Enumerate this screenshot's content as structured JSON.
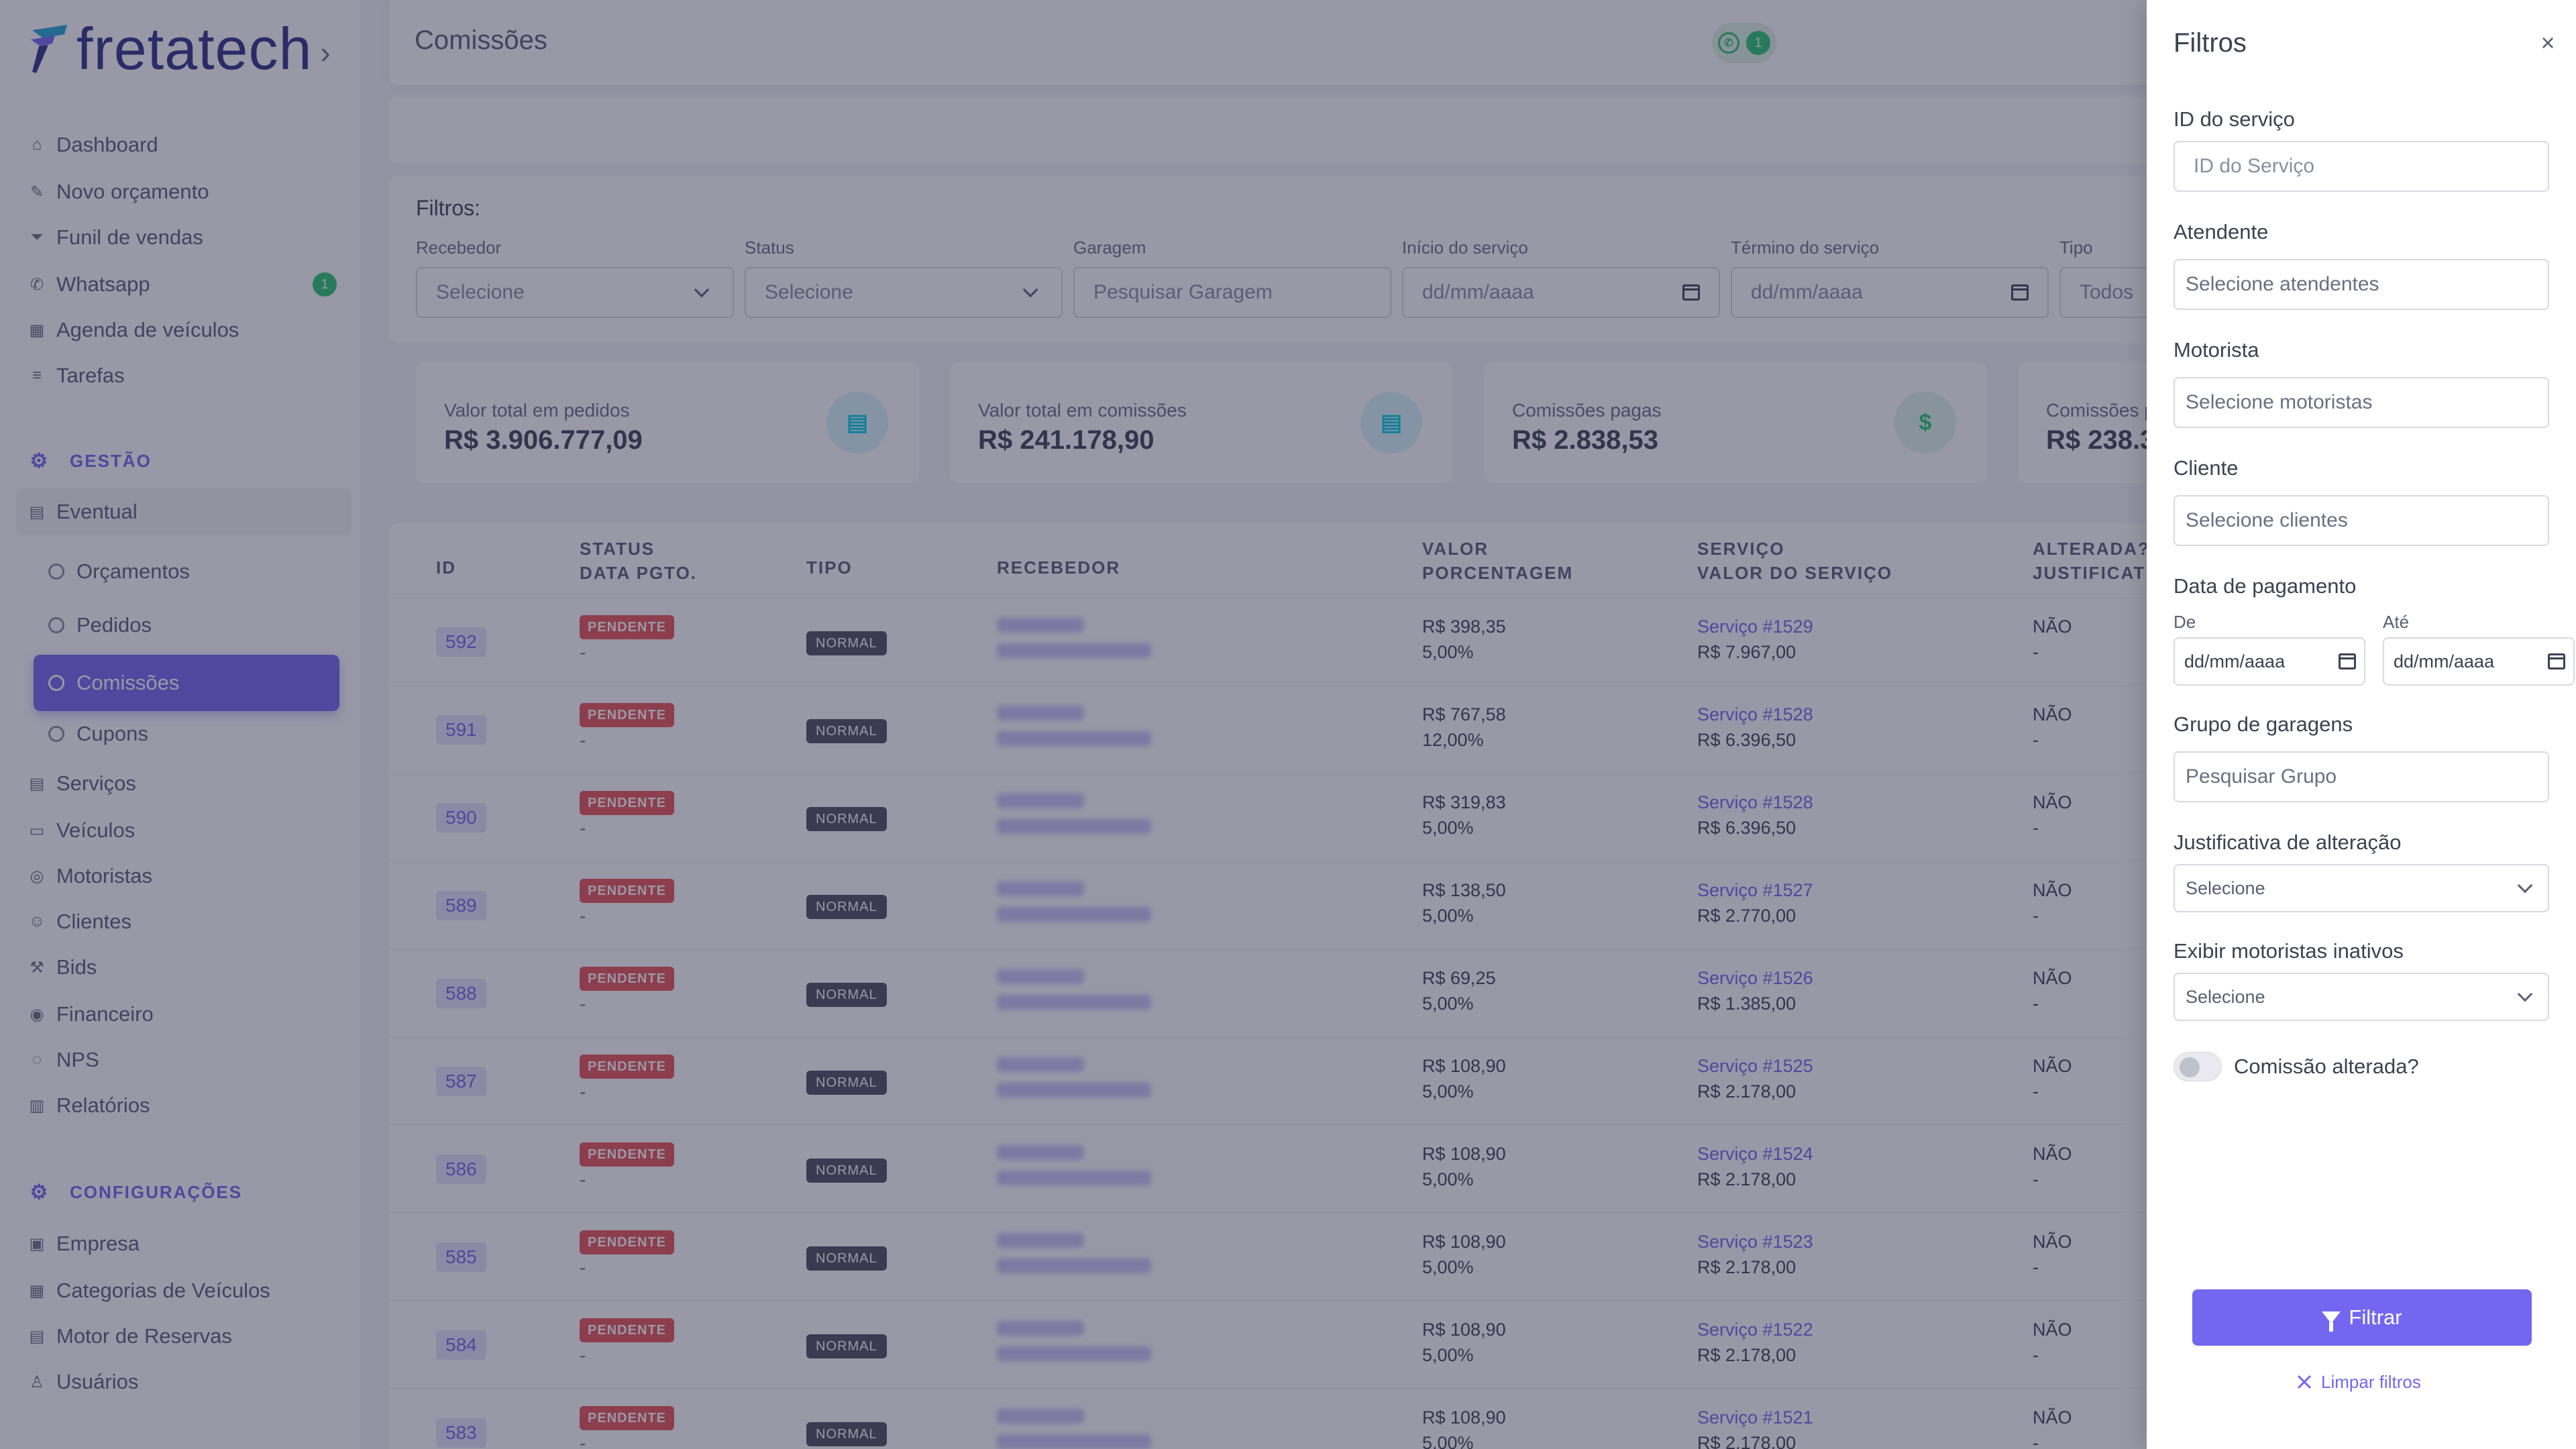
{
  "app": {
    "logo_text": "fretatech",
    "page_title": "Comissões",
    "whatsapp_count": "1"
  },
  "sidebar": {
    "top_items": [
      {
        "label": "Dashboard",
        "icon": "home-icon"
      },
      {
        "label": "Novo orçamento",
        "icon": "edit-icon"
      },
      {
        "label": "Funil de vendas",
        "icon": "funnel-icon"
      },
      {
        "label": "Whatsapp",
        "icon": "whatsapp-icon",
        "badge": "1"
      },
      {
        "label": "Agenda de veículos",
        "icon": "calendar-icon"
      },
      {
        "label": "Tarefas",
        "icon": "list-icon"
      }
    ],
    "section_gestao": "GESTÃO",
    "eventual": "Eventual",
    "eventual_sub": [
      "Orçamentos",
      "Pedidos",
      "Comissões",
      "Cupons"
    ],
    "gestao_items": [
      {
        "label": "Serviços",
        "icon": "clipboard-icon"
      },
      {
        "label": "Veículos",
        "icon": "bus-icon"
      },
      {
        "label": "Motoristas",
        "icon": "steering-wheel-icon"
      },
      {
        "label": "Clientes",
        "icon": "users-icon"
      },
      {
        "label": "Bids",
        "icon": "gavel-icon"
      },
      {
        "label": "Financeiro",
        "icon": "money-icon"
      },
      {
        "label": "NPS",
        "icon": "chat-icon"
      },
      {
        "label": "Relatórios",
        "icon": "report-icon"
      }
    ],
    "section_config": "CONFIGURAÇÕES",
    "config_items": [
      {
        "label": "Empresa",
        "icon": "building-icon"
      },
      {
        "label": "Categorias de Veículos",
        "icon": "grid-icon"
      },
      {
        "label": "Motor de Reservas",
        "icon": "table-icon"
      },
      {
        "label": "Usuários",
        "icon": "user-icon"
      }
    ]
  },
  "filters": {
    "title": "Filtros:",
    "fields": [
      {
        "label": "Recebedor",
        "value": "Selecione",
        "type": "select"
      },
      {
        "label": "Status",
        "value": "Selecione",
        "type": "select"
      },
      {
        "label": "Garagem",
        "value": "Pesquisar Garagem",
        "type": "text"
      },
      {
        "label": "Início do serviço",
        "value": "dd/mm/aaaa",
        "type": "date"
      },
      {
        "label": "Término do serviço",
        "value": "dd/mm/aaaa",
        "type": "date"
      },
      {
        "label": "Tipo",
        "value": "Todos",
        "type": "select"
      }
    ]
  },
  "stats": [
    {
      "label": "Valor total em pedidos",
      "value": "R$ 3.906.777,09",
      "icon": "document-icon",
      "color": "#00cfe8"
    },
    {
      "label": "Valor total em comissões",
      "value": "R$ 241.178,90",
      "icon": "document-icon",
      "color": "#00cfe8"
    },
    {
      "label": "Comissões pagas",
      "value": "R$ 2.838,53",
      "icon": "dollar-icon",
      "color": "#28c76f"
    },
    {
      "label": "Comissões p",
      "value": "R$ 238.3",
      "icon": "",
      "color": "#ea5455"
    }
  ],
  "table": {
    "headers": {
      "id": "ID",
      "status": "STATUS",
      "data_pgto": "DATA PGTO.",
      "tipo": "TIPO",
      "recebedor": "RECEBEDOR",
      "valor": "VALOR",
      "porcentagem": "PORCENTAGEM",
      "servico": "SERVIÇO",
      "valor_servico": "VALOR DO SERVIÇO",
      "alterada": "ALTERADA?",
      "justificativa": "JUSTIFICATIV"
    },
    "rows": [
      {
        "id": "592",
        "status": "PENDENTE",
        "data": "-",
        "tipo": "NORMAL",
        "valor": "R$ 398,35",
        "pct": "5,00%",
        "servico": "Serviço #1529",
        "valor_servico": "R$ 7.967,00",
        "alterada": "NÃO",
        "just": "-"
      },
      {
        "id": "591",
        "status": "PENDENTE",
        "data": "-",
        "tipo": "NORMAL",
        "valor": "R$ 767,58",
        "pct": "12,00%",
        "servico": "Serviço #1528",
        "valor_servico": "R$ 6.396,50",
        "alterada": "NÃO",
        "just": "-"
      },
      {
        "id": "590",
        "status": "PENDENTE",
        "data": "-",
        "tipo": "NORMAL",
        "valor": "R$ 319,83",
        "pct": "5,00%",
        "servico": "Serviço #1528",
        "valor_servico": "R$ 6.396,50",
        "alterada": "NÃO",
        "just": "-"
      },
      {
        "id": "589",
        "status": "PENDENTE",
        "data": "-",
        "tipo": "NORMAL",
        "valor": "R$ 138,50",
        "pct": "5,00%",
        "servico": "Serviço #1527",
        "valor_servico": "R$ 2.770,00",
        "alterada": "NÃO",
        "just": "-"
      },
      {
        "id": "588",
        "status": "PENDENTE",
        "data": "-",
        "tipo": "NORMAL",
        "valor": "R$ 69,25",
        "pct": "5,00%",
        "servico": "Serviço #1526",
        "valor_servico": "R$ 1.385,00",
        "alterada": "NÃO",
        "just": "-"
      },
      {
        "id": "587",
        "status": "PENDENTE",
        "data": "-",
        "tipo": "NORMAL",
        "valor": "R$ 108,90",
        "pct": "5,00%",
        "servico": "Serviço #1525",
        "valor_servico": "R$ 2.178,00",
        "alterada": "NÃO",
        "just": "-"
      },
      {
        "id": "586",
        "status": "PENDENTE",
        "data": "-",
        "tipo": "NORMAL",
        "valor": "R$ 108,90",
        "pct": "5,00%",
        "servico": "Serviço #1524",
        "valor_servico": "R$ 2.178,00",
        "alterada": "NÃO",
        "just": "-"
      },
      {
        "id": "585",
        "status": "PENDENTE",
        "data": "-",
        "tipo": "NORMAL",
        "valor": "R$ 108,90",
        "pct": "5,00%",
        "servico": "Serviço #1523",
        "valor_servico": "R$ 2.178,00",
        "alterada": "NÃO",
        "just": "-"
      },
      {
        "id": "584",
        "status": "PENDENTE",
        "data": "-",
        "tipo": "NORMAL",
        "valor": "R$ 108,90",
        "pct": "5,00%",
        "servico": "Serviço #1522",
        "valor_servico": "R$ 2.178,00",
        "alterada": "NÃO",
        "just": "-"
      },
      {
        "id": "583",
        "status": "PENDENTE",
        "data": "-",
        "tipo": "NORMAL",
        "valor": "R$ 108,90",
        "pct": "5,00%",
        "servico": "Serviço #1521",
        "valor_servico": "R$ 2.178,00",
        "alterada": "NÃO",
        "just": "-"
      }
    ]
  },
  "drawer": {
    "title": "Filtros",
    "id_servico": {
      "label": "ID do serviço",
      "placeholder": "ID do Serviço"
    },
    "atendente": {
      "label": "Atendente",
      "placeholder": "Selecione atendentes"
    },
    "motorista": {
      "label": "Motorista",
      "placeholder": "Selecione motoristas"
    },
    "cliente": {
      "label": "Cliente",
      "placeholder": "Selecione clientes"
    },
    "data_pagamento": {
      "label": "Data de pagamento",
      "de": "De",
      "ate": "Até",
      "de_value": "dd/mm/aaaa",
      "ate_value": "dd/mm/aaaa"
    },
    "grupo_garagens": {
      "label": "Grupo de garagens",
      "placeholder": "Pesquisar Grupo"
    },
    "justificativa": {
      "label": "Justificativa de alteração",
      "value": "Selecione"
    },
    "inativos": {
      "label": "Exibir motoristas inativos",
      "value": "Selecione"
    },
    "comissao_alterada": {
      "label": "Comissão alterada?",
      "checked": false
    },
    "filter_button": "Filtrar",
    "clear_link": "Limpar filtros"
  },
  "colors": {
    "primary": "#7367f0",
    "success": "#28c76f",
    "danger": "#ea5455",
    "info": "#00cfe8"
  }
}
